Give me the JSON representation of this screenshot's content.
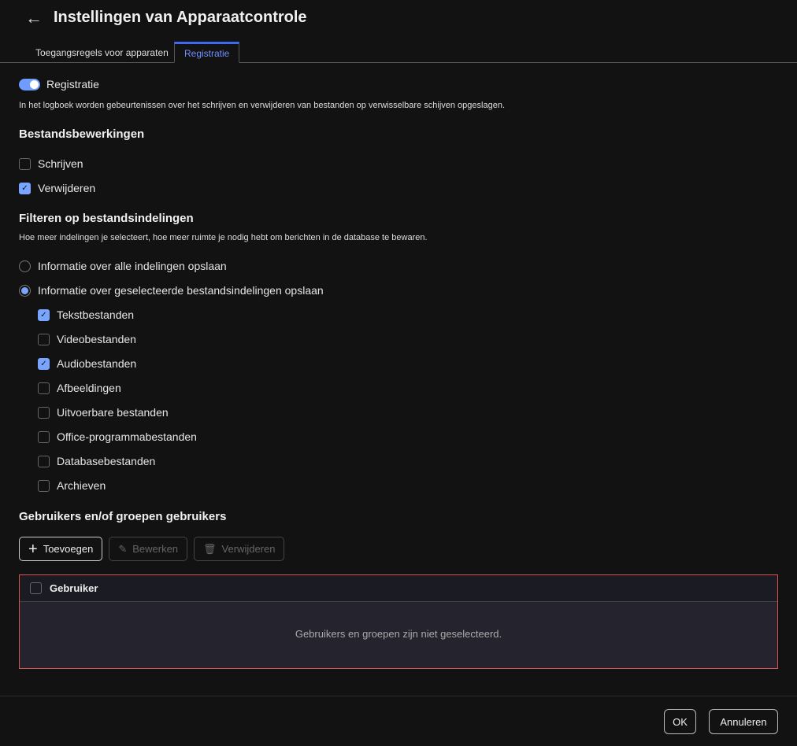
{
  "header": {
    "title": "Instellingen van Apparaatcontrole",
    "back": "←"
  },
  "tabs": [
    {
      "label": "Toegangsregels voor apparaten"
    },
    {
      "label": "Registratie"
    }
  ],
  "logging": {
    "toggle_label": "Registratie",
    "enabled": true,
    "description": "In het logboek worden gebeurtenissen over het schrijven en verwijderen van bestanden op verwisselbare schijven opgeslagen."
  },
  "file_ops": {
    "heading": "Bestandsbewerkingen",
    "items": [
      {
        "label": "Schrijven",
        "checked": false
      },
      {
        "label": "Verwijderen",
        "checked": true
      }
    ]
  },
  "filter": {
    "heading": "Filteren op bestandsindelingen",
    "description": "Hoe meer indelingen je selecteert, hoe meer ruimte je nodig hebt om berichten in de database te bewaren.",
    "radios": [
      {
        "label": "Informatie over alle indelingen opslaan",
        "selected": false
      },
      {
        "label": "Informatie over geselecteerde bestandsindelingen opslaan",
        "selected": true
      }
    ],
    "formats": [
      {
        "label": "Tekstbestanden",
        "checked": true
      },
      {
        "label": "Videobestanden",
        "checked": false
      },
      {
        "label": "Audiobestanden",
        "checked": true
      },
      {
        "label": "Afbeeldingen",
        "checked": false
      },
      {
        "label": "Uitvoerbare bestanden",
        "checked": false
      },
      {
        "label": "Office-programmabestanden",
        "checked": false
      },
      {
        "label": "Databasebestanden",
        "checked": false
      },
      {
        "label": "Archieven",
        "checked": false
      }
    ]
  },
  "users": {
    "heading": "Gebruikers en/of groepen gebruikers",
    "add": "Toevoegen",
    "edit": "Bewerken",
    "delete": "Verwijderen",
    "column": "Gebruiker",
    "empty": "Gebruikers en groepen zijn niet geselecteerd."
  },
  "footer": {
    "ok": "OK",
    "cancel": "Annuleren"
  }
}
